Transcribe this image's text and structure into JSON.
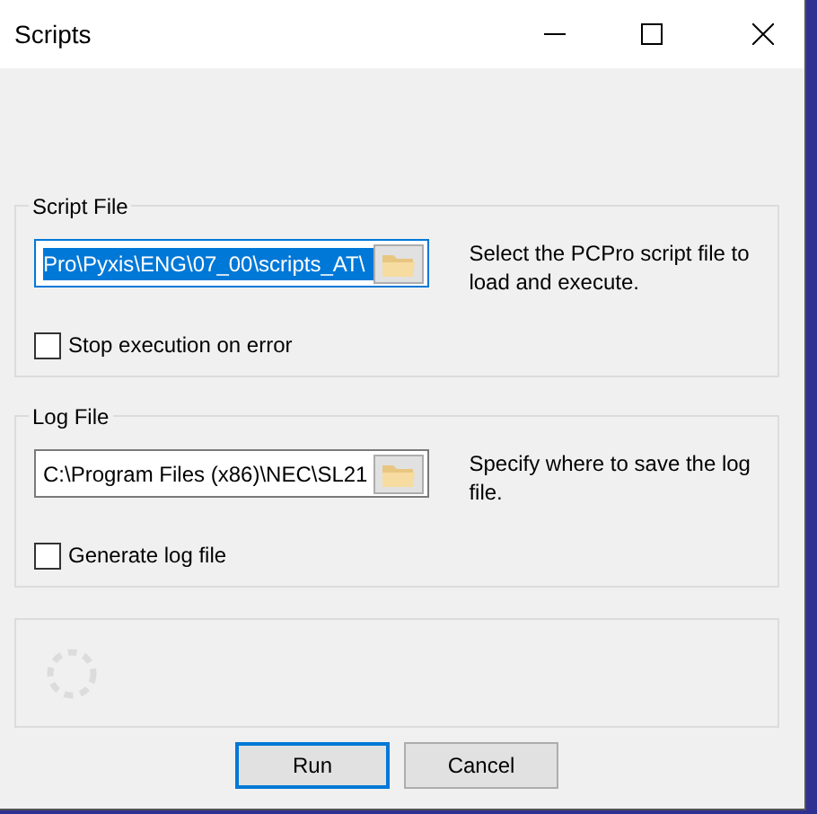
{
  "window": {
    "title": "Scripts"
  },
  "groups": [
    {
      "title": "Script File",
      "path": "Pro\\Pyxis\\ENG\\07_00\\scripts_AT\\",
      "path_selected": true,
      "description": "Select the PCPro script file to load and execute.",
      "checkbox": {
        "label": "Stop execution on error",
        "checked": false
      }
    },
    {
      "title": "Log File",
      "path": "C:\\Program Files (x86)\\NEC\\SL21",
      "path_selected": false,
      "description": "Specify where to save the log file.",
      "checkbox": {
        "label": "Generate log file",
        "checked": false
      }
    }
  ],
  "buttons": [
    {
      "label": "Run",
      "default": true
    },
    {
      "label": "Cancel",
      "default": false
    }
  ]
}
